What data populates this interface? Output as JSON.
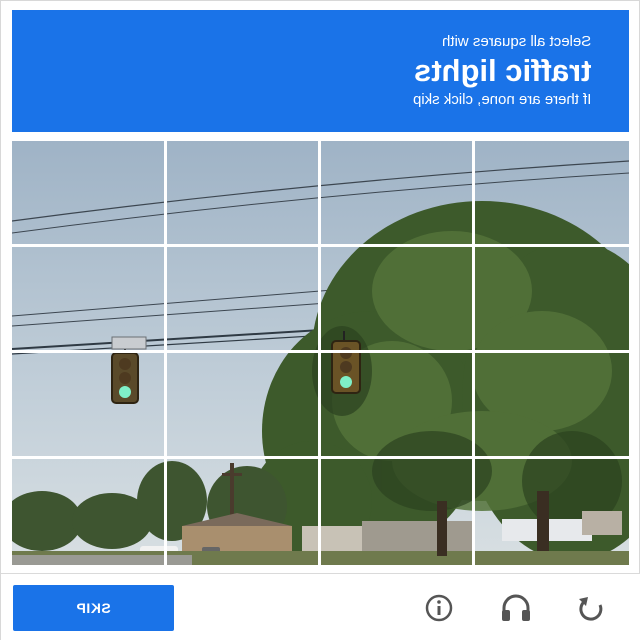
{
  "header": {
    "line1": "Select all squares with",
    "target": "traffic lights",
    "line3": "If there are none, click skip"
  },
  "grid": {
    "rows": 4,
    "cols": 4
  },
  "footer": {
    "skip_label": "SKIP",
    "icons": [
      "info-icon",
      "audio-headphones-icon",
      "reload-icon"
    ]
  },
  "colors": {
    "accent": "#1a73e8"
  }
}
